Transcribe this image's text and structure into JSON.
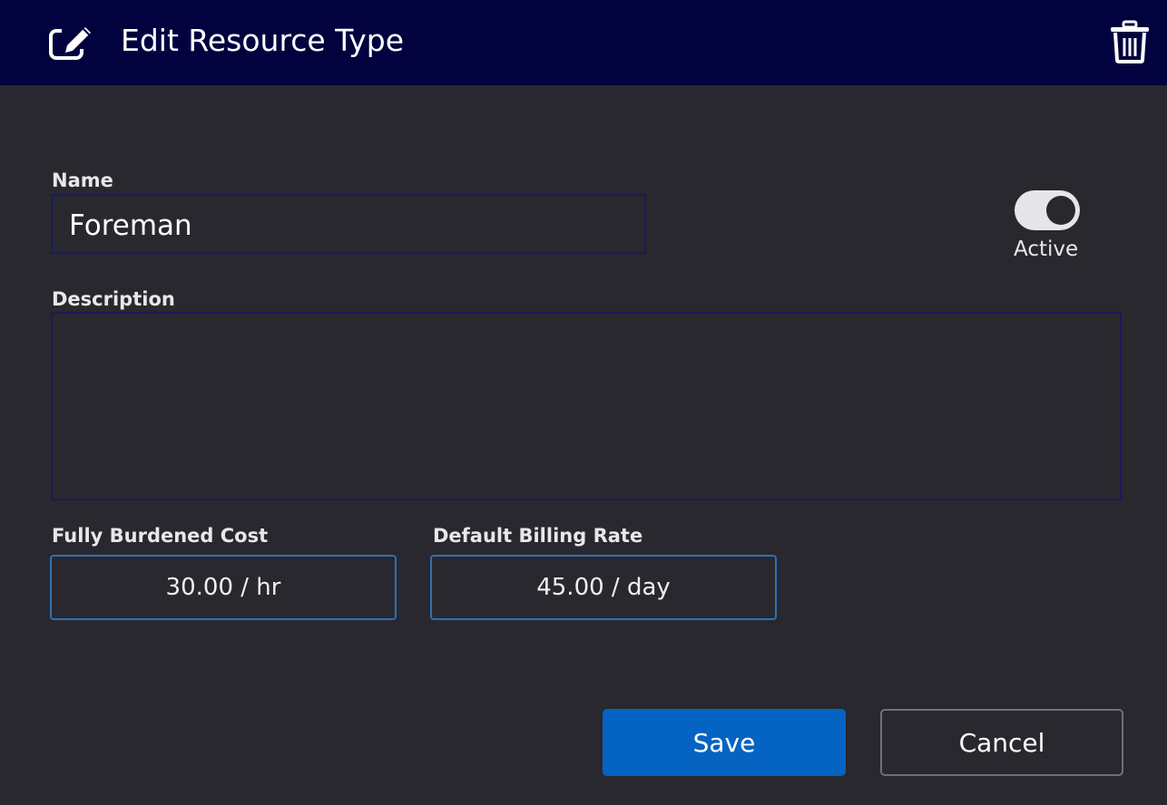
{
  "dialog": {
    "title": "Edit Resource Type",
    "title_icon": "edit-icon",
    "delete_icon": "trash-icon"
  },
  "form": {
    "name_label": "Name",
    "name_value": "Foreman",
    "description_label": "Description",
    "description_value": "",
    "active_label": "Active",
    "active": true,
    "cost_label": "Fully Burdened Cost",
    "cost_value": "30.00 / hr",
    "rate_label": "Default Billing Rate",
    "rate_value": "45.00 / day"
  },
  "actions": {
    "save_label": "Save",
    "cancel_label": "Cancel"
  },
  "colors": {
    "header_bg": "#02023f",
    "body_bg": "#28282e",
    "primary": "#0563c1",
    "field_border_focus": "#2d6fb8"
  }
}
